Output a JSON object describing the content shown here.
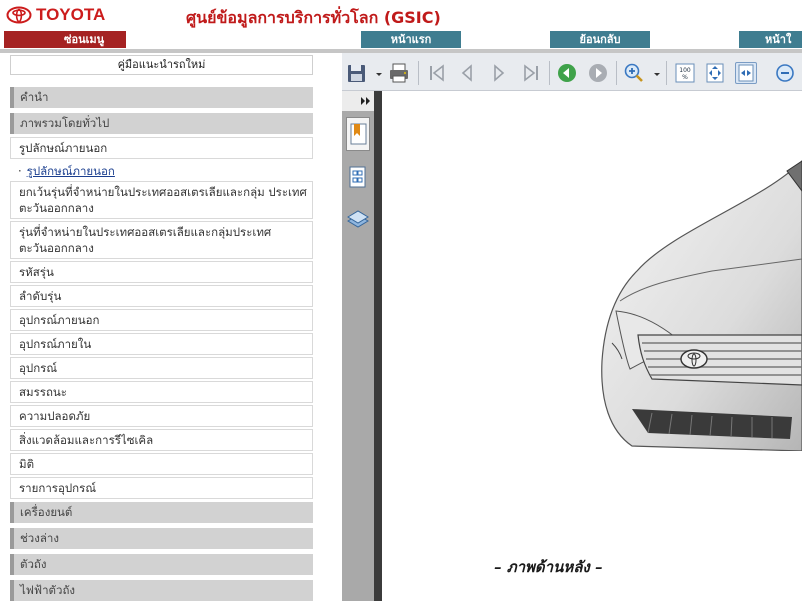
{
  "header": {
    "logo_text": "TOYOTA",
    "title": "ศูนย์ข้อมูลการบริการทั่วโลก (GSIC)"
  },
  "nav": {
    "hide_menu": "ซ่อนเมนู",
    "home": "หน้าแรก",
    "back": "ย้อนกลับ",
    "next": "หน้าใ"
  },
  "sidebar": {
    "title": "คู่มือแนะนำรถใหม่",
    "items": [
      {
        "label": "คำนำ",
        "kind": "group"
      },
      {
        "label": "ภาพรวมโดยทั่วไป",
        "kind": "group"
      },
      {
        "label": "รูปลักษณ์ภายนอก",
        "kind": "link"
      },
      {
        "label": "รูปลักษณ์ภายนอก",
        "kind": "sub"
      },
      {
        "label": "ยกเว้นรุ่นที่จำหน่ายในประเทศออสเตรเลียและกลุ่ม ประเทศตะวันออกกลาง",
        "kind": "two"
      },
      {
        "label": "รุ่นที่จำหน่ายในประเทศออสเตรเลียและกลุ่มประเทศ ตะวันออกกลาง",
        "kind": "two"
      },
      {
        "label": "รหัสรุ่น",
        "kind": "link"
      },
      {
        "label": "ลำดับรุ่น",
        "kind": "link"
      },
      {
        "label": "อุปกรณ์ภายนอก",
        "kind": "link"
      },
      {
        "label": "อุปกรณ์ภายใน",
        "kind": "link"
      },
      {
        "label": "อุปกรณ์",
        "kind": "link"
      },
      {
        "label": "สมรรถนะ",
        "kind": "link"
      },
      {
        "label": "ความปลอดภัย",
        "kind": "link"
      },
      {
        "label": "สิ่งแวดล้อมและการรีไซเคิล",
        "kind": "link"
      },
      {
        "label": "มิติ",
        "kind": "link"
      },
      {
        "label": "รายการอุปกรณ์",
        "kind": "link"
      },
      {
        "label": "เครื่องยนต์",
        "kind": "group"
      },
      {
        "label": "ช่วงล่าง",
        "kind": "group"
      },
      {
        "label": "ตัวถัง",
        "kind": "group"
      },
      {
        "label": "ไฟฟ้าตัวถัง",
        "kind": "group"
      }
    ]
  },
  "viewer": {
    "caption": "– ภาพด้านหลัง –"
  },
  "colors": {
    "brand_red": "#cc1c1c",
    "nav_red": "#a52222",
    "nav_teal": "#3f7d90"
  },
  "icons": [
    "save-icon",
    "print-icon",
    "first-page-icon",
    "previous-page-icon",
    "next-page-icon",
    "last-page-icon",
    "go-back-icon",
    "go-forward-icon",
    "zoom-in-icon",
    "actual-size-icon",
    "fit-page-icon",
    "fit-width-icon",
    "zoom-out-icon",
    "bookmarks-icon",
    "thumbnails-icon",
    "layers-icon"
  ]
}
